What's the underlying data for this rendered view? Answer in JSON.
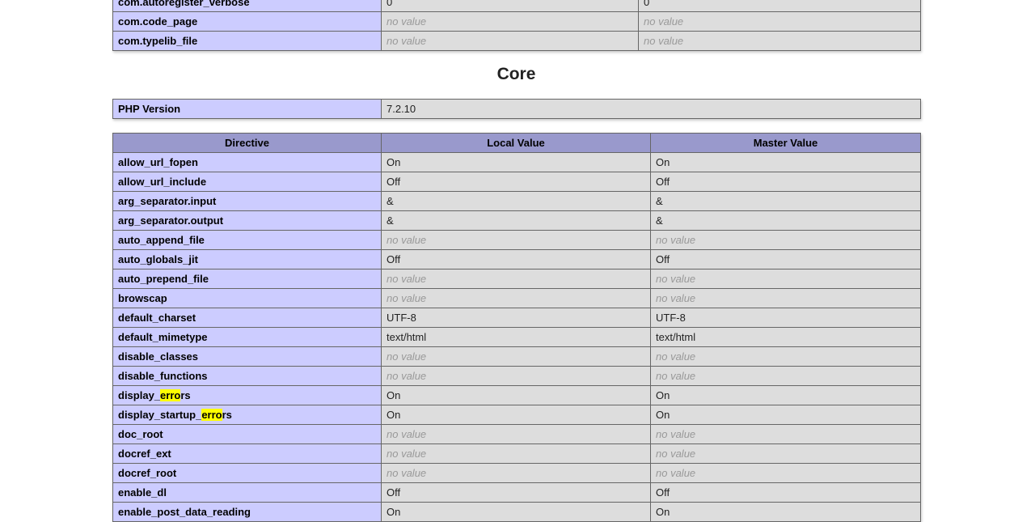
{
  "com_table": {
    "rows": [
      {
        "directive": "com.autoregister_verbose",
        "local": "0",
        "master": "0",
        "local_nv": false,
        "master_nv": false
      },
      {
        "directive": "com.code_page",
        "local": "no value",
        "master": "no value",
        "local_nv": true,
        "master_nv": true
      },
      {
        "directive": "com.typelib_file",
        "local": "no value",
        "master": "no value",
        "local_nv": true,
        "master_nv": true
      }
    ]
  },
  "core": {
    "heading": "Core",
    "php_version_label": "PHP Version",
    "php_version_value": "7.2.10",
    "headers": {
      "directive": "Directive",
      "local": "Local Value",
      "master": "Master Value"
    },
    "rows": [
      {
        "directive": "allow_url_fopen",
        "local": "On",
        "master": "On"
      },
      {
        "directive": "allow_url_include",
        "local": "Off",
        "master": "Off"
      },
      {
        "directive": "arg_separator.input",
        "local": "&",
        "master": "&"
      },
      {
        "directive": "arg_separator.output",
        "local": "&",
        "master": "&"
      },
      {
        "directive": "auto_append_file",
        "local": "no value",
        "master": "no value",
        "nv": true
      },
      {
        "directive": "auto_globals_jit",
        "local": "Off",
        "master": "Off"
      },
      {
        "directive": "auto_prepend_file",
        "local": "no value",
        "master": "no value",
        "nv": true
      },
      {
        "directive": "browscap",
        "local": "no value",
        "master": "no value",
        "nv": true
      },
      {
        "directive": "default_charset",
        "local": "UTF-8",
        "master": "UTF-8"
      },
      {
        "directive": "default_mimetype",
        "local": "text/html",
        "master": "text/html"
      },
      {
        "directive": "disable_classes",
        "local": "no value",
        "master": "no value",
        "nv": true
      },
      {
        "directive": "disable_functions",
        "local": "no value",
        "master": "no value",
        "nv": true
      },
      {
        "directive": "display_errors",
        "local": "On",
        "master": "On",
        "highlight": [
          "display_",
          "erro",
          "rs"
        ]
      },
      {
        "directive": "display_startup_errors",
        "local": "On",
        "master": "On",
        "highlight": [
          "display_startup_",
          "erro",
          "rs"
        ]
      },
      {
        "directive": "doc_root",
        "local": "no value",
        "master": "no value",
        "nv": true
      },
      {
        "directive": "docref_ext",
        "local": "no value",
        "master": "no value",
        "nv": true
      },
      {
        "directive": "docref_root",
        "local": "no value",
        "master": "no value",
        "nv": true
      },
      {
        "directive": "enable_dl",
        "local": "Off",
        "master": "Off"
      },
      {
        "directive": "enable_post_data_reading",
        "local": "On",
        "master": "On"
      }
    ]
  },
  "colors": {
    "header_bg": "#9999cc",
    "directive_bg": "#ccccff",
    "value_bg": "#dddddd",
    "search_highlight": "#ffff00"
  }
}
